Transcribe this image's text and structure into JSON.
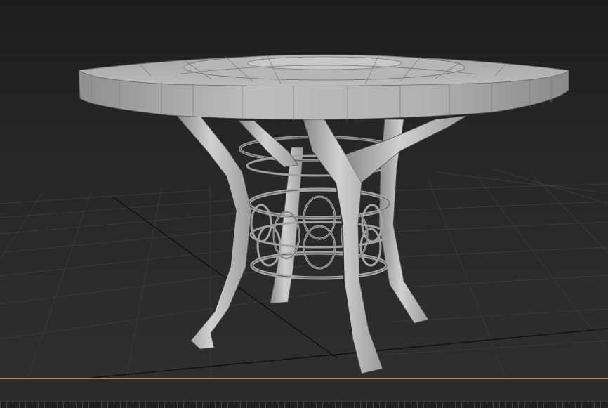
{
  "app": {
    "view": "perspective-viewport",
    "object": "round-table-model"
  },
  "colors": {
    "background": "#262626",
    "grid": "#3a3a3a",
    "grid_axis": "#101010",
    "model_light": "#c4c4c4",
    "model_mid": "#a8a8a8",
    "model_dark": "#7a7a7a",
    "wire_edges": "#5a5a5a",
    "time_slider": "#b08a3a"
  }
}
